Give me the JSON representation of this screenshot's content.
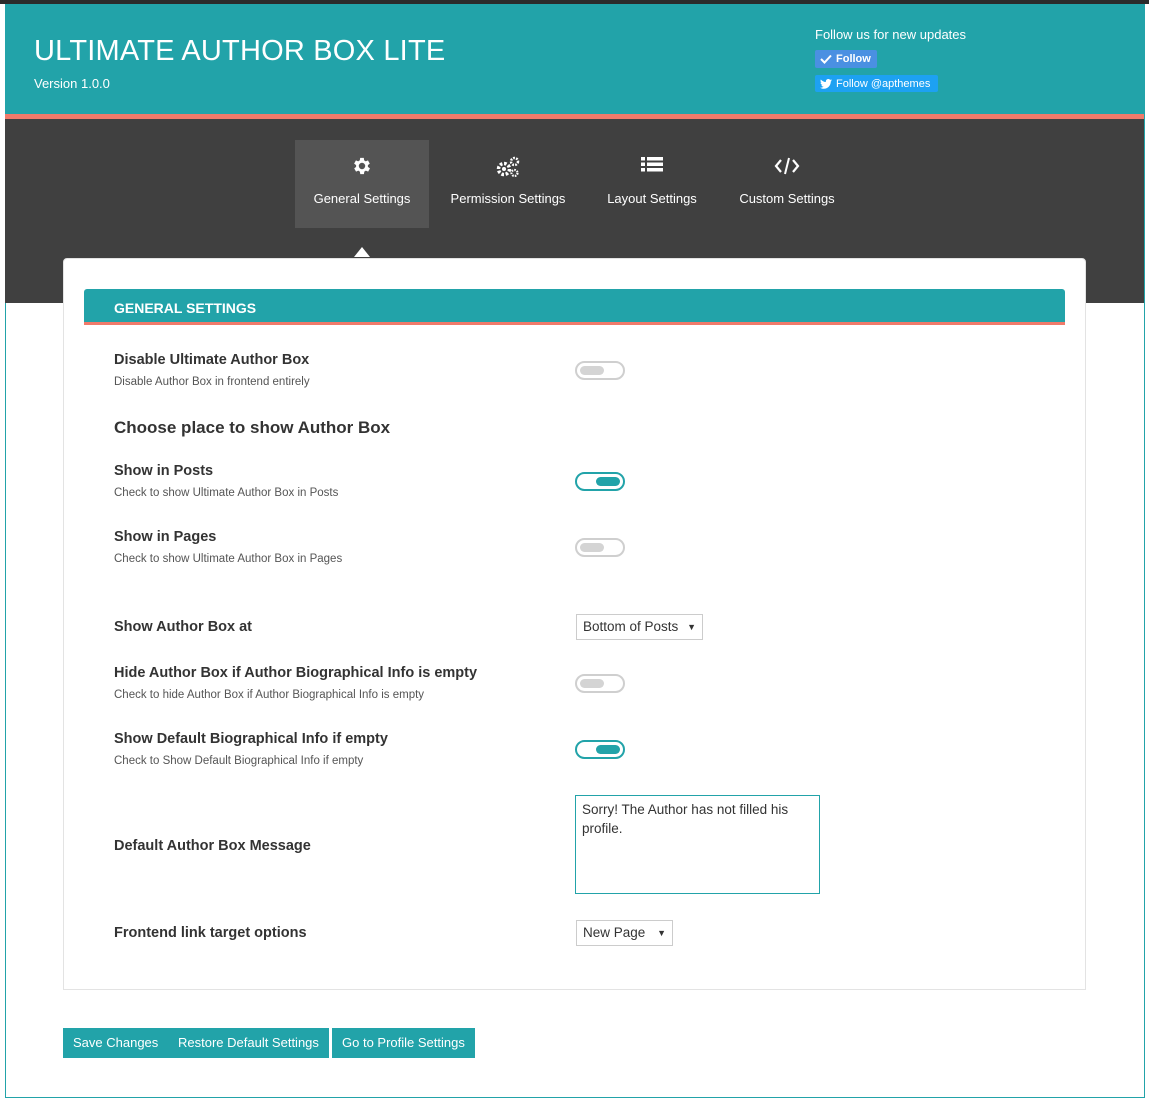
{
  "header": {
    "title": "ULTIMATE AUTHOR BOX LITE",
    "version": "Version 1.0.0",
    "follow_text": "Follow us for new updates",
    "follow_button": "Follow",
    "twitter_button": "Follow @apthemes"
  },
  "tabs": [
    {
      "label": "General Settings",
      "icon": "gear-icon",
      "active": true
    },
    {
      "label": "Permission Settings",
      "icon": "gears-icon",
      "active": false
    },
    {
      "label": "Layout Settings",
      "icon": "list-icon",
      "active": false
    },
    {
      "label": "Custom Settings",
      "icon": "code-icon",
      "active": false
    }
  ],
  "section": {
    "title": "GENERAL SETTINGS",
    "choose_heading": "Choose place to show Author Box"
  },
  "settings": {
    "disable": {
      "label": "Disable Ultimate Author Box",
      "desc": "Disable Author Box in frontend entirely",
      "enabled": false
    },
    "show_posts": {
      "label": "Show in Posts",
      "desc": "Check to show Ultimate Author Box in Posts",
      "enabled": true
    },
    "show_pages": {
      "label": "Show in Pages",
      "desc": "Check to show Ultimate Author Box in Pages",
      "enabled": false
    },
    "show_at": {
      "label": "Show Author Box at",
      "value": "Bottom of Posts"
    },
    "hide_empty": {
      "label": "Hide Author Box if Author Biographical Info is empty",
      "desc": "Check to hide Author Box if Author Biographical Info is empty",
      "enabled": false
    },
    "default_bio": {
      "label": "Show Default Biographical Info if empty",
      "desc": "Check to Show Default Biographical Info if empty",
      "enabled": true
    },
    "default_message": {
      "label": "Default Author Box Message",
      "value": "Sorry! The Author has not filled his profile."
    },
    "link_target": {
      "label": "Frontend link target options",
      "value": "New Page"
    }
  },
  "buttons": {
    "save": "Save Changes",
    "restore": "Restore Default Settings",
    "profile": "Go to Profile Settings"
  },
  "colors": {
    "accent": "#22a3a9",
    "stripe": "#f07a6a",
    "dark_band": "#404040"
  }
}
